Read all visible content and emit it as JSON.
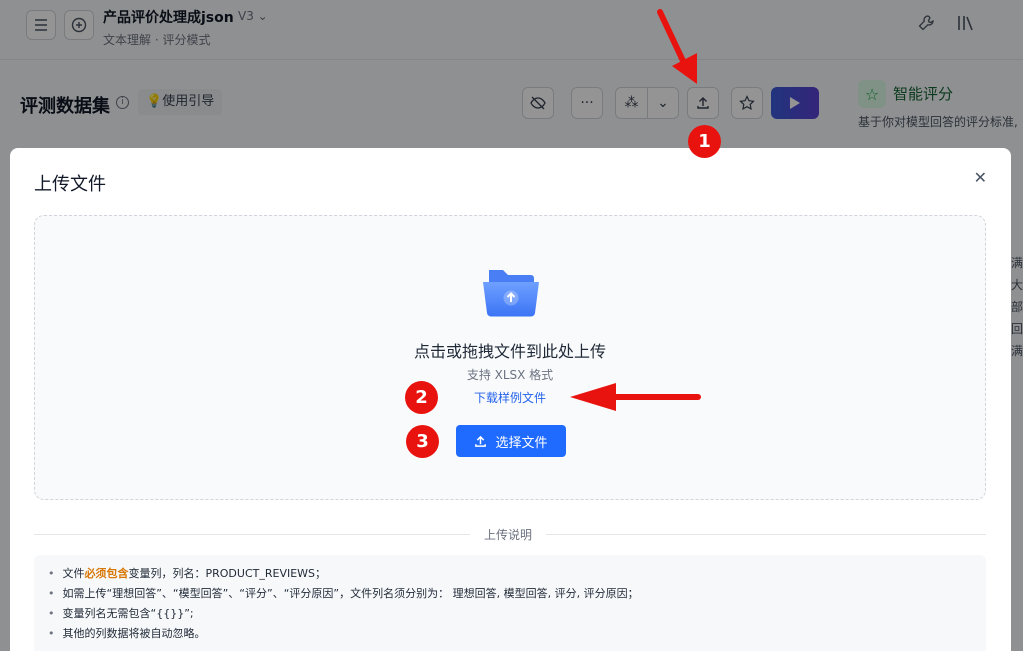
{
  "header": {
    "title": "产品评价处理成json",
    "version": "V3",
    "subtitle": "文本理解 · 评分模式"
  },
  "toolbar": {
    "dataset_title": "评测数据集",
    "guide_label": "使用引导"
  },
  "right_panel": {
    "title": "智能评分",
    "subtitle": "基于你对模型回答的评分标准,",
    "fragments": [
      "满",
      "大",
      "部",
      "回",
      "满"
    ]
  },
  "modal": {
    "title": "上传文件",
    "dropzone_text": "点击或拖拽文件到此处上传",
    "format_text": "支持 XLSX 格式",
    "download_link": "下载样例文件",
    "select_button": "选择文件",
    "notes_title": "上传说明",
    "notes": {
      "n1_pre": "文件",
      "n1_hl": "必须包含",
      "n1_post": "变量列，列名：PRODUCT_REVIEWS；",
      "n2": "如需上传“理想回答”、“模型回答”、“评分”、“评分原因”，文件列名须分别为： 理想回答, 模型回答, 评分, 评分原因；",
      "n3": "变量列名无需包含“{{}}”;",
      "n4": "其他的列数据将被自动忽略。"
    }
  },
  "annotations": {
    "badge1": "1",
    "badge2": "2",
    "badge3": "3"
  },
  "colors": {
    "primary": "#1f6bff",
    "annotation_red": "#e8130f",
    "highlight": "#d97706"
  }
}
